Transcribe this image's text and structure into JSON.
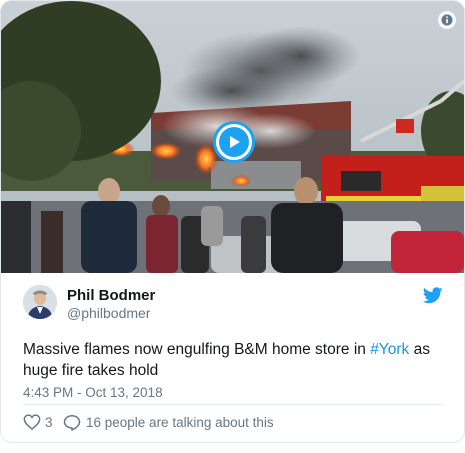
{
  "author": {
    "name": "Phil Bodmer",
    "handle": "@philbodmer"
  },
  "tweet": {
    "text_before": "Massive flames now engulfing B&M home store in ",
    "hashtag": "#York",
    "text_after": " as huge fire takes hold",
    "timestamp": "4:43 PM - Oct 13, 2018"
  },
  "actions": {
    "like_count": "3",
    "talking_text": "16 people are talking about this"
  },
  "icons": {
    "info": "info-icon",
    "play": "play-icon",
    "bird": "twitter-bird-icon",
    "like": "heart-icon",
    "reply": "reply-bubble-icon"
  },
  "colors": {
    "accent": "#1da1f2",
    "link": "#1b95e0",
    "secondary_text": "#657786",
    "border": "#e1e8ed"
  }
}
